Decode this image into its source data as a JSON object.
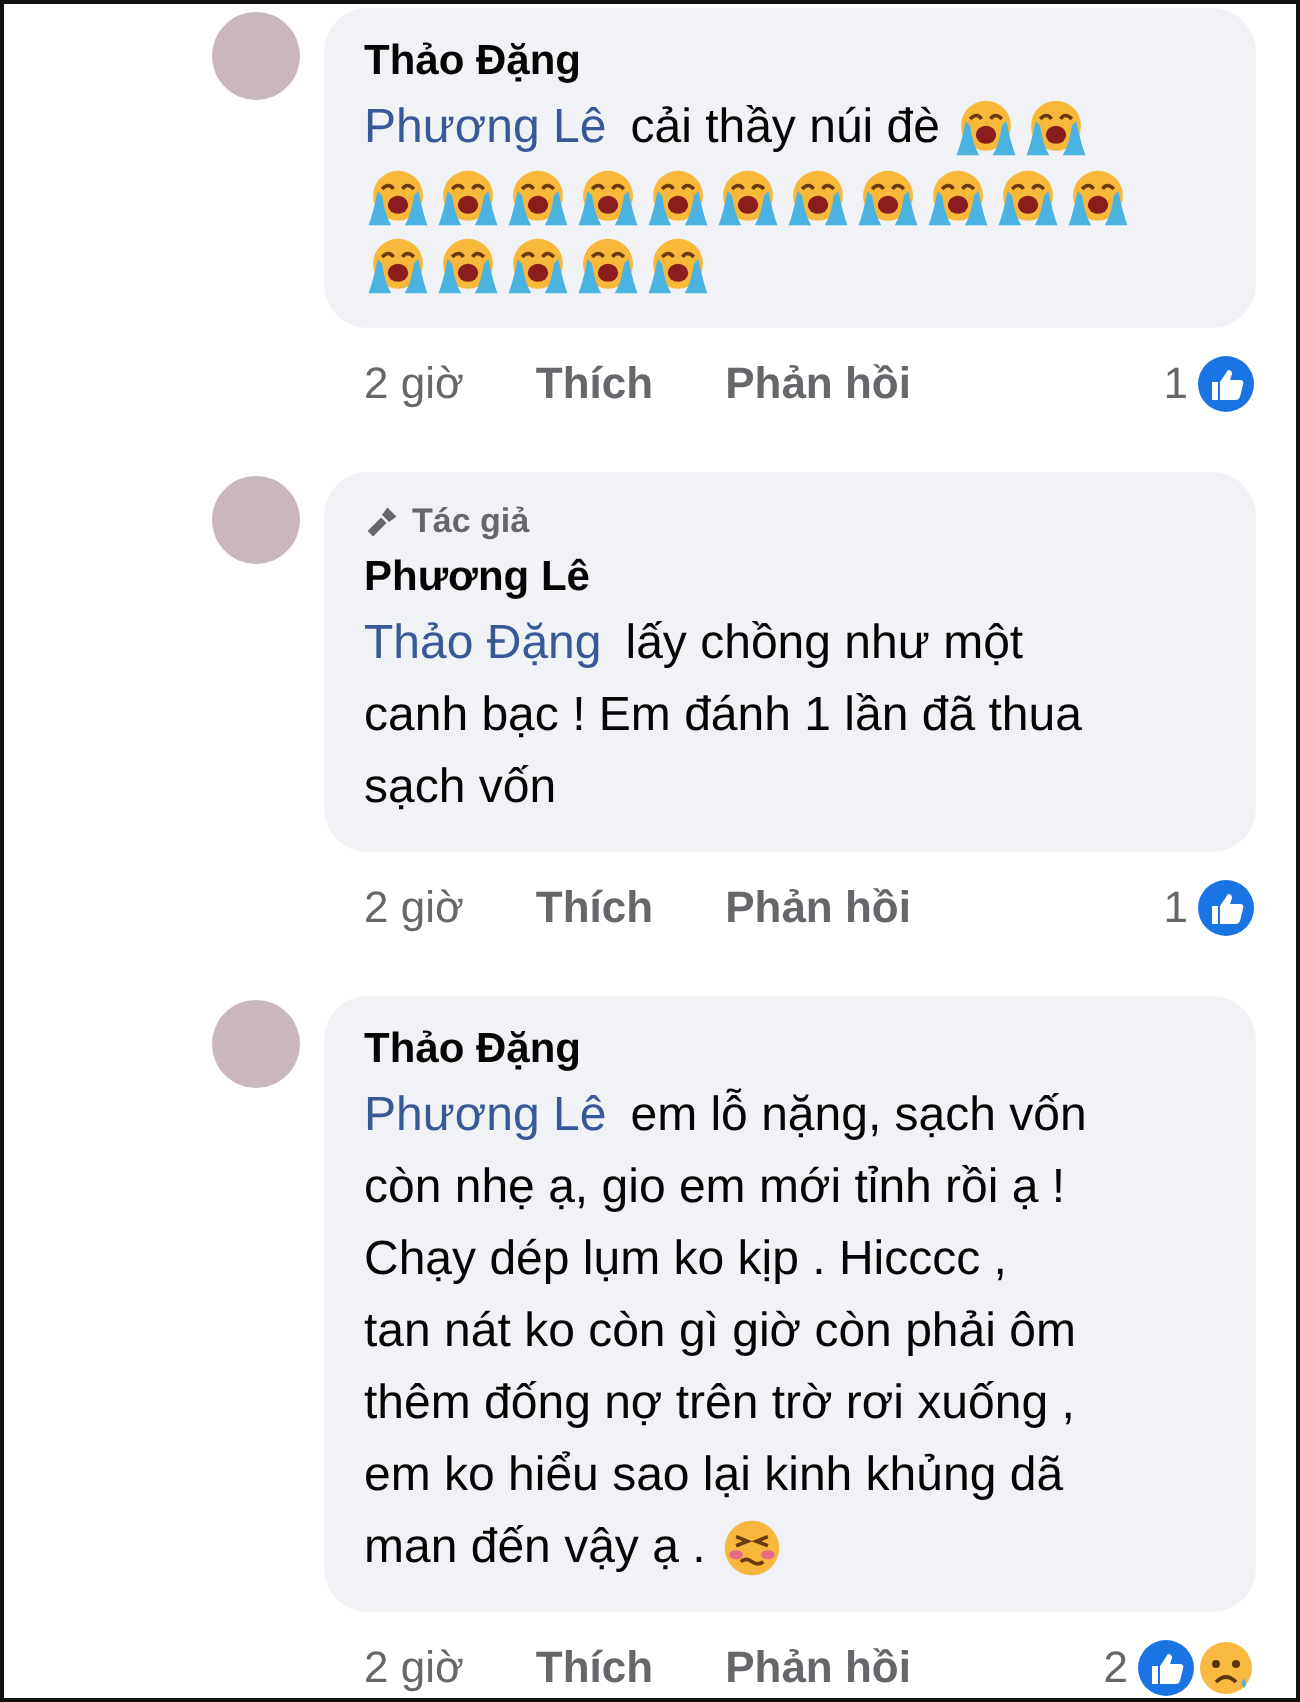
{
  "comments": [
    {
      "author": "Thảo Đặng",
      "mention": "Phương Lê",
      "lines": [
        {
          "text": "cải thầy núi đè",
          "emojis": [
            {
              "kind": "crying"
            },
            {
              "kind": "crying"
            }
          ]
        },
        {
          "emojis": [
            {
              "kind": "crying"
            },
            {
              "kind": "crying"
            },
            {
              "kind": "crying"
            },
            {
              "kind": "crying"
            },
            {
              "kind": "crying"
            },
            {
              "kind": "crying"
            },
            {
              "kind": "crying"
            },
            {
              "kind": "crying"
            },
            {
              "kind": "crying"
            },
            {
              "kind": "crying"
            },
            {
              "kind": "crying"
            }
          ]
        },
        {
          "emojis": [
            {
              "kind": "crying"
            },
            {
              "kind": "crying"
            },
            {
              "kind": "crying"
            },
            {
              "kind": "crying"
            },
            {
              "kind": "crying"
            }
          ]
        }
      ],
      "time": "2 giờ",
      "like": "Thích",
      "reply": "Phản hồi",
      "reaction_count": "1",
      "reactions": [
        {
          "kind": "like"
        }
      ]
    },
    {
      "author": "Phương Lê",
      "badge": "Tác giả",
      "mention": "Thảo Đặng",
      "lines": [
        {
          "text": "lấy chồng như một"
        },
        {
          "text": "canh bạc ! Em đánh 1 lần đã thua"
        },
        {
          "text": "sạch vốn"
        }
      ],
      "time": "2 giờ",
      "like": "Thích",
      "reply": "Phản hồi",
      "reaction_count": "1",
      "reactions": [
        {
          "kind": "like"
        }
      ]
    },
    {
      "author": "Thảo Đặng",
      "mention": "Phương Lê",
      "lines": [
        {
          "text": "em lỗ nặng, sạch vốn"
        },
        {
          "text": "còn nhẹ ạ,  gio em mới tỉnh rồi ạ !"
        },
        {
          "text": "Chạy dép lụm ko kịp . Hicccc ,"
        },
        {
          "text": "tan nát ko còn gì giờ còn phải ôm"
        },
        {
          "text": "thêm đống nợ trên trờ rơi xuống ,"
        },
        {
          "text": "em ko hiểu sao lại kinh khủng dã"
        },
        {
          "text": "man đến vậy ạ .",
          "emojis": [
            {
              "kind": "tired"
            }
          ]
        }
      ],
      "time": "2 giờ",
      "like": "Thích",
      "reply": "Phản hồi",
      "reaction_count": "2",
      "reactions": [
        {
          "kind": "like"
        },
        {
          "kind": "sad"
        }
      ]
    }
  ]
}
